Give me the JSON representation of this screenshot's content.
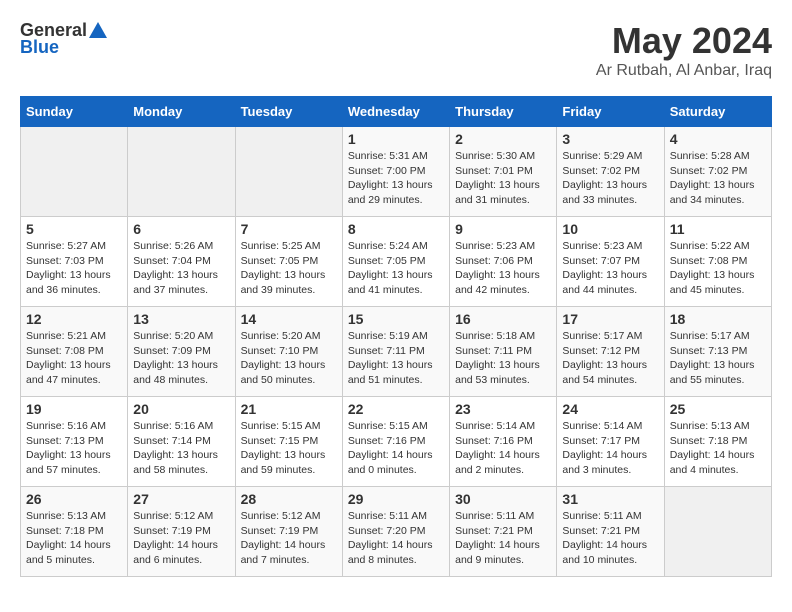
{
  "header": {
    "logo_general": "General",
    "logo_blue": "Blue",
    "title": "May 2024",
    "location": "Ar Rutbah, Al Anbar, Iraq"
  },
  "days_of_week": [
    "Sunday",
    "Monday",
    "Tuesday",
    "Wednesday",
    "Thursday",
    "Friday",
    "Saturday"
  ],
  "weeks": [
    [
      {
        "day": "",
        "info": ""
      },
      {
        "day": "",
        "info": ""
      },
      {
        "day": "",
        "info": ""
      },
      {
        "day": "1",
        "info": "Sunrise: 5:31 AM\nSunset: 7:00 PM\nDaylight: 13 hours\nand 29 minutes."
      },
      {
        "day": "2",
        "info": "Sunrise: 5:30 AM\nSunset: 7:01 PM\nDaylight: 13 hours\nand 31 minutes."
      },
      {
        "day": "3",
        "info": "Sunrise: 5:29 AM\nSunset: 7:02 PM\nDaylight: 13 hours\nand 33 minutes."
      },
      {
        "day": "4",
        "info": "Sunrise: 5:28 AM\nSunset: 7:02 PM\nDaylight: 13 hours\nand 34 minutes."
      }
    ],
    [
      {
        "day": "5",
        "info": "Sunrise: 5:27 AM\nSunset: 7:03 PM\nDaylight: 13 hours\nand 36 minutes."
      },
      {
        "day": "6",
        "info": "Sunrise: 5:26 AM\nSunset: 7:04 PM\nDaylight: 13 hours\nand 37 minutes."
      },
      {
        "day": "7",
        "info": "Sunrise: 5:25 AM\nSunset: 7:05 PM\nDaylight: 13 hours\nand 39 minutes."
      },
      {
        "day": "8",
        "info": "Sunrise: 5:24 AM\nSunset: 7:05 PM\nDaylight: 13 hours\nand 41 minutes."
      },
      {
        "day": "9",
        "info": "Sunrise: 5:23 AM\nSunset: 7:06 PM\nDaylight: 13 hours\nand 42 minutes."
      },
      {
        "day": "10",
        "info": "Sunrise: 5:23 AM\nSunset: 7:07 PM\nDaylight: 13 hours\nand 44 minutes."
      },
      {
        "day": "11",
        "info": "Sunrise: 5:22 AM\nSunset: 7:08 PM\nDaylight: 13 hours\nand 45 minutes."
      }
    ],
    [
      {
        "day": "12",
        "info": "Sunrise: 5:21 AM\nSunset: 7:08 PM\nDaylight: 13 hours\nand 47 minutes."
      },
      {
        "day": "13",
        "info": "Sunrise: 5:20 AM\nSunset: 7:09 PM\nDaylight: 13 hours\nand 48 minutes."
      },
      {
        "day": "14",
        "info": "Sunrise: 5:20 AM\nSunset: 7:10 PM\nDaylight: 13 hours\nand 50 minutes."
      },
      {
        "day": "15",
        "info": "Sunrise: 5:19 AM\nSunset: 7:11 PM\nDaylight: 13 hours\nand 51 minutes."
      },
      {
        "day": "16",
        "info": "Sunrise: 5:18 AM\nSunset: 7:11 PM\nDaylight: 13 hours\nand 53 minutes."
      },
      {
        "day": "17",
        "info": "Sunrise: 5:17 AM\nSunset: 7:12 PM\nDaylight: 13 hours\nand 54 minutes."
      },
      {
        "day": "18",
        "info": "Sunrise: 5:17 AM\nSunset: 7:13 PM\nDaylight: 13 hours\nand 55 minutes."
      }
    ],
    [
      {
        "day": "19",
        "info": "Sunrise: 5:16 AM\nSunset: 7:13 PM\nDaylight: 13 hours\nand 57 minutes."
      },
      {
        "day": "20",
        "info": "Sunrise: 5:16 AM\nSunset: 7:14 PM\nDaylight: 13 hours\nand 58 minutes."
      },
      {
        "day": "21",
        "info": "Sunrise: 5:15 AM\nSunset: 7:15 PM\nDaylight: 13 hours\nand 59 minutes."
      },
      {
        "day": "22",
        "info": "Sunrise: 5:15 AM\nSunset: 7:16 PM\nDaylight: 14 hours\nand 0 minutes."
      },
      {
        "day": "23",
        "info": "Sunrise: 5:14 AM\nSunset: 7:16 PM\nDaylight: 14 hours\nand 2 minutes."
      },
      {
        "day": "24",
        "info": "Sunrise: 5:14 AM\nSunset: 7:17 PM\nDaylight: 14 hours\nand 3 minutes."
      },
      {
        "day": "25",
        "info": "Sunrise: 5:13 AM\nSunset: 7:18 PM\nDaylight: 14 hours\nand 4 minutes."
      }
    ],
    [
      {
        "day": "26",
        "info": "Sunrise: 5:13 AM\nSunset: 7:18 PM\nDaylight: 14 hours\nand 5 minutes."
      },
      {
        "day": "27",
        "info": "Sunrise: 5:12 AM\nSunset: 7:19 PM\nDaylight: 14 hours\nand 6 minutes."
      },
      {
        "day": "28",
        "info": "Sunrise: 5:12 AM\nSunset: 7:19 PM\nDaylight: 14 hours\nand 7 minutes."
      },
      {
        "day": "29",
        "info": "Sunrise: 5:11 AM\nSunset: 7:20 PM\nDaylight: 14 hours\nand 8 minutes."
      },
      {
        "day": "30",
        "info": "Sunrise: 5:11 AM\nSunset: 7:21 PM\nDaylight: 14 hours\nand 9 minutes."
      },
      {
        "day": "31",
        "info": "Sunrise: 5:11 AM\nSunset: 7:21 PM\nDaylight: 14 hours\nand 10 minutes."
      },
      {
        "day": "",
        "info": ""
      }
    ]
  ]
}
